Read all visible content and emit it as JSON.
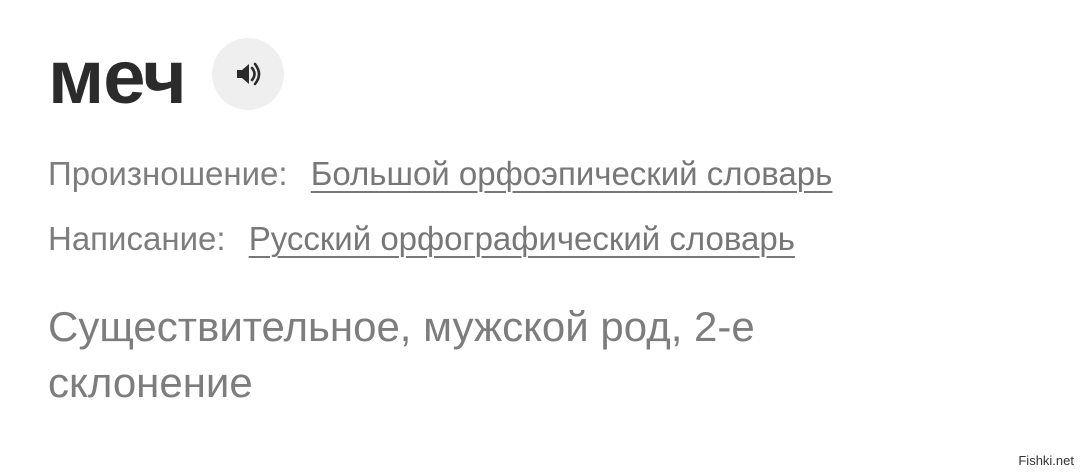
{
  "entry": {
    "word": "меч",
    "audio_icon": "speaker-icon"
  },
  "pronunciation": {
    "label": "Произношение:",
    "link": "Большой орфоэпический словарь"
  },
  "spelling": {
    "label": "Написание:",
    "link": "Русский орфографический словарь"
  },
  "grammar": {
    "text": "Существительное, мужской род, 2-е склонение"
  },
  "watermark": "Fishki.net",
  "colors": {
    "headword": "#2b2b2b",
    "secondary_text": "#7d7d7d",
    "audio_button_bg": "#efefef"
  }
}
